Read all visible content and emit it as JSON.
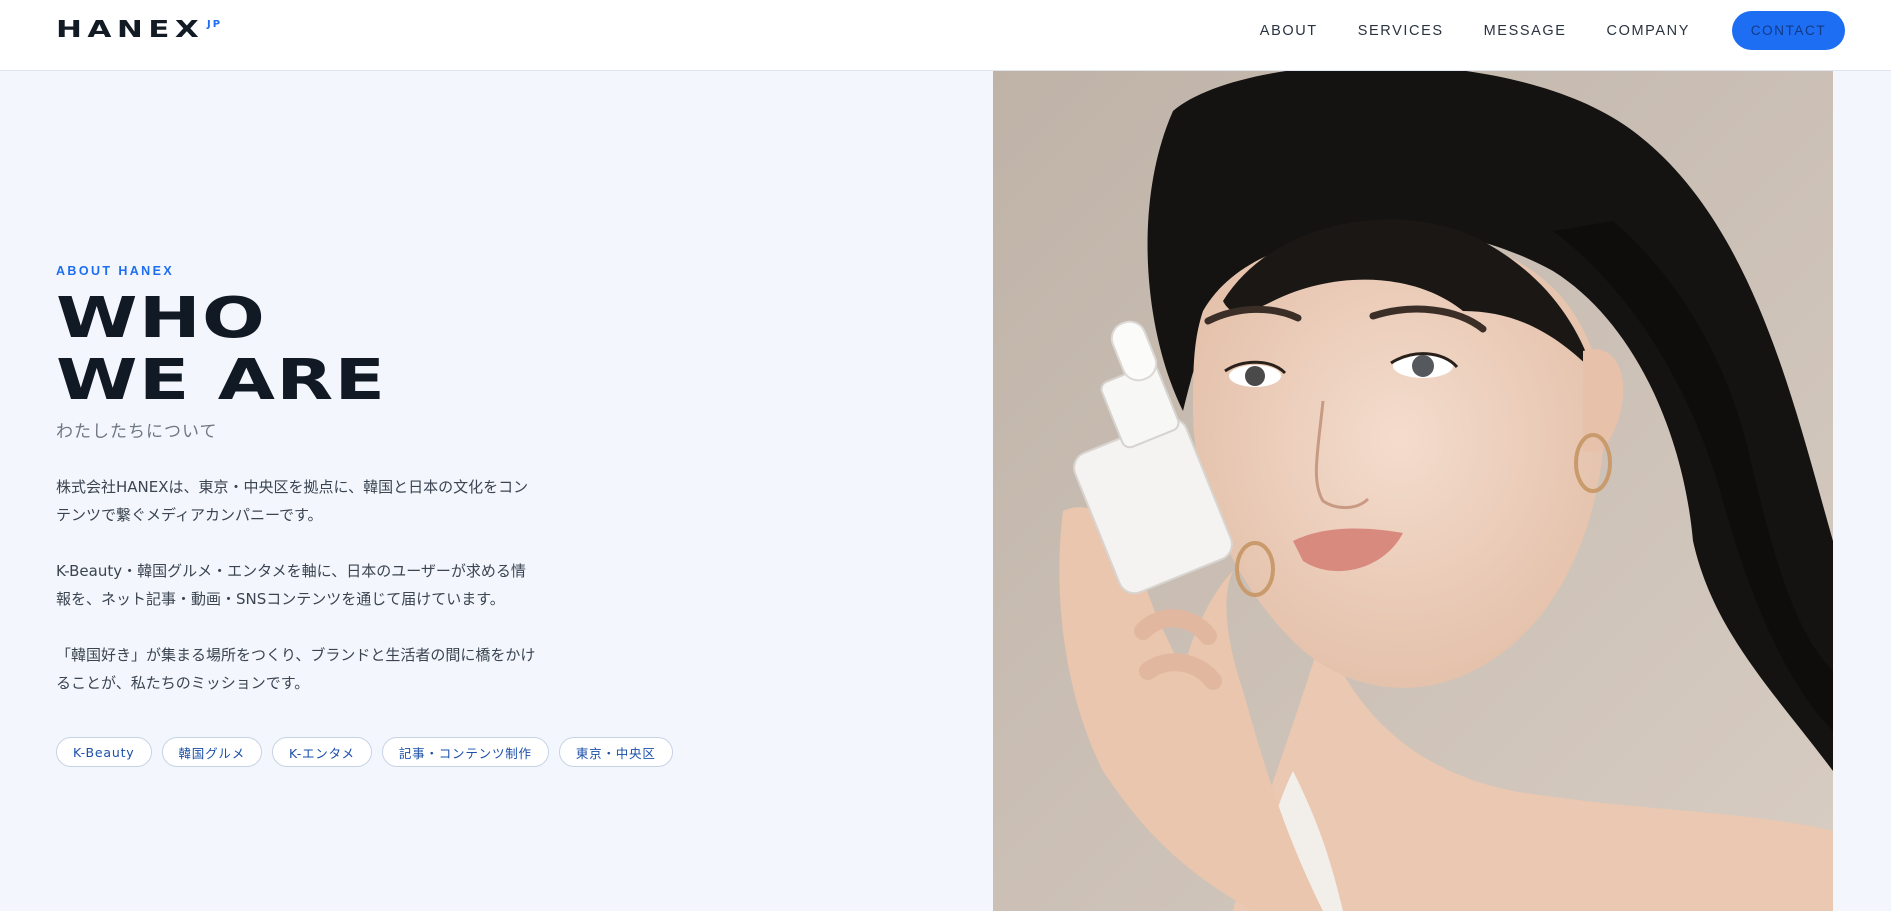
{
  "header": {
    "logo_main": "HANEX",
    "logo_sup": "JP",
    "nav": [
      "ABOUT",
      "SERVICES",
      "MESSAGE",
      "COMPANY"
    ],
    "contact": "CONTACT"
  },
  "about": {
    "eyebrow": "ABOUT HANEX",
    "headline_line1": "WHO",
    "headline_line2": "WE ARE",
    "subtitle": "わたしたちについて",
    "paragraphs": [
      "株式会社HANEXは、東京・中央区を拠点に、韓国と日本の文化をコンテンツで繋ぐメディアカンパニーです。",
      "K-Beauty・韓国グルメ・エンタメを軸に、日本のユーザーが求める情報を、ネット記事・動画・SNSコンテンツを通じて届けています。",
      "「韓国好き」が集まる場所をつくり、ブランドと生活者の間に橋をかけることが、私たちのミッションです。"
    ],
    "tags": [
      "K-Beauty",
      "韓国グルメ",
      "K-エンタメ",
      "記事・コンテンツ制作",
      "東京・中央区"
    ]
  },
  "colors": {
    "accent": "#1d6ef2",
    "background": "#f3f7fd",
    "heading": "#111a24"
  }
}
